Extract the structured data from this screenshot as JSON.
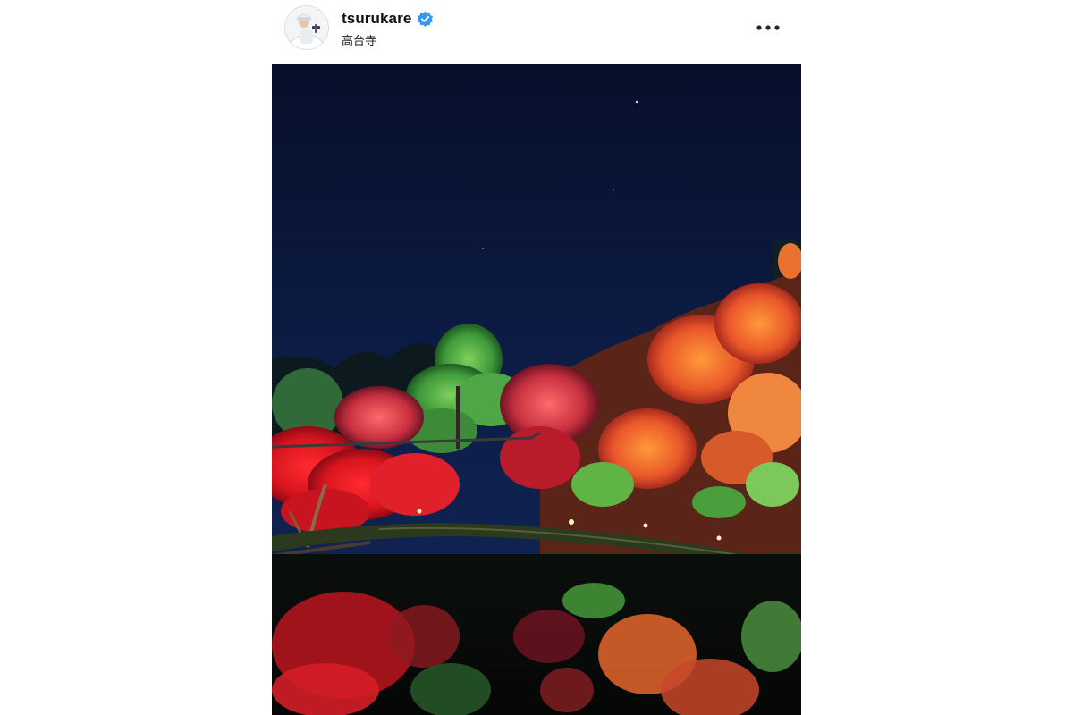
{
  "post": {
    "username": "tsurukare",
    "verified": true,
    "location": "高台寺",
    "more_icon": "more-horizontal-icon",
    "avatar_icon": "profile-avatar",
    "photo_description_icon": "post-photo"
  },
  "colors": {
    "verified_badge": "#3897f0",
    "username_text": "#111111",
    "sky_top": "#0b1a3e",
    "foliage_red": "#e0202a",
    "foliage_orange": "#f07a2a"
  }
}
